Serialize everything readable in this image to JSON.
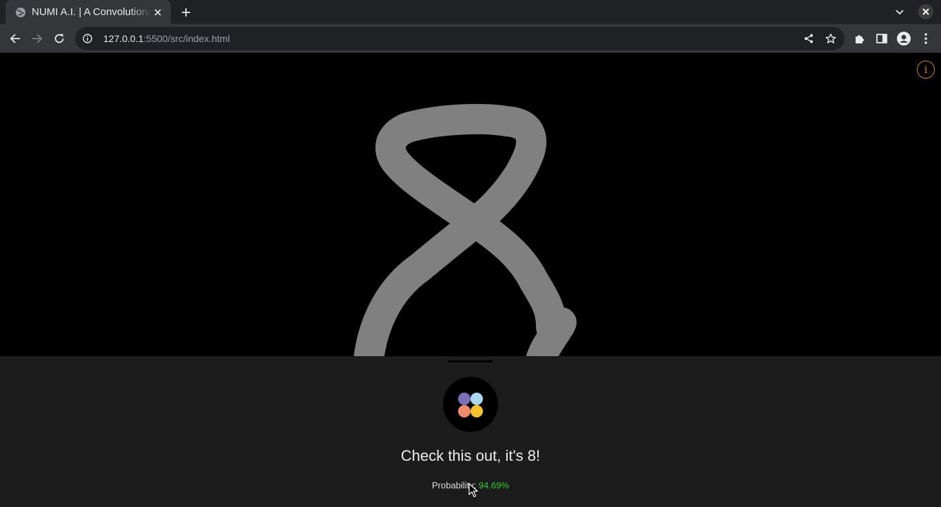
{
  "browser": {
    "tab_title": "NUMI A.I. | A Convolutional Neural Network",
    "url_host": "127.0.0.1",
    "url_path": ":5500/src/index.html"
  },
  "icons": [
    "globe-icon",
    "close-icon",
    "plus-icon",
    "chevron-down-icon",
    "back-icon",
    "forward-icon",
    "reload-icon",
    "info-icon",
    "share-icon",
    "star-icon",
    "puzzle-icon",
    "sidepanel-icon",
    "profile-icon",
    "menu-icon",
    "app-logo-icon"
  ],
  "colors": {
    "stroke": "#808080",
    "accent_info": "#c88a1e",
    "probability": "#2ecc2e",
    "logo": [
      "#7b6fb8",
      "#a9d8f0",
      "#f08a6c",
      "#f6c22e"
    ]
  },
  "app": {
    "info_label": "i",
    "result_text": "Check this out, it's 8!",
    "probability_label": "Probability: ",
    "probability_value": "94.69%"
  }
}
